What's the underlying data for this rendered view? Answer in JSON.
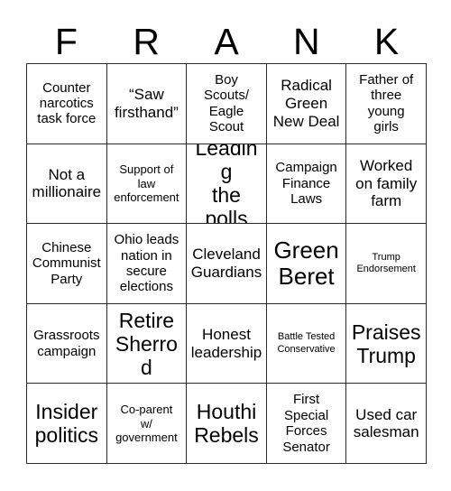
{
  "card": {
    "header_letters": [
      "F",
      "R",
      "A",
      "N",
      "K"
    ],
    "columns": 5,
    "rows": 5,
    "background_color": "#ffffff",
    "text_color": "#000000",
    "border_color": "#2b2b2b",
    "cells": [
      {
        "text": "Counter\nnarcotics\ntask force",
        "size": "sm"
      },
      {
        "text": "“Saw\nfirsthand”",
        "size": "md"
      },
      {
        "text": "Boy\nScouts/\nEagle\nScout",
        "size": "sm"
      },
      {
        "text": "Radical\nGreen\nNew Deal",
        "size": "md"
      },
      {
        "text": "Father of\nthree\nyoung\ngirls",
        "size": "sm"
      },
      {
        "text": "Not a\nmillionaire",
        "size": "md"
      },
      {
        "text": "Support of\nlaw\nenforcement",
        "size": "xs"
      },
      {
        "text": "Leading\nthe\npolls",
        "size": "lg"
      },
      {
        "text": "Campaign\nFinance\nLaws",
        "size": "sm"
      },
      {
        "text": "Worked\non family\nfarm",
        "size": "md"
      },
      {
        "text": "Chinese\nCommunist\nParty",
        "size": "sm"
      },
      {
        "text": "Ohio leads\nnation in\nsecure\nelections",
        "size": "sm"
      },
      {
        "text": "Cleveland\nGuardians",
        "size": "md"
      },
      {
        "text": "Green\nBeret",
        "size": "xl"
      },
      {
        "text": "Trump\nEndorsement",
        "size": "xxs"
      },
      {
        "text": "Grassroots\ncampaign",
        "size": "sm"
      },
      {
        "text": "Retire\nSherrod",
        "size": "lg"
      },
      {
        "text": "Honest\nleadership",
        "size": "md"
      },
      {
        "text": "Battle Tested\nConservative",
        "size": "xxs"
      },
      {
        "text": "Praises\nTrump",
        "size": "lg"
      },
      {
        "text": "Insider\npolitics",
        "size": "lg"
      },
      {
        "text": "Co-parent\nw/\ngovernment",
        "size": "xs"
      },
      {
        "text": "Houthi\nRebels",
        "size": "lg"
      },
      {
        "text": "First\nSpecial\nForces\nSenator",
        "size": "sm"
      },
      {
        "text": "Used car\nsalesman",
        "size": "md"
      }
    ]
  }
}
